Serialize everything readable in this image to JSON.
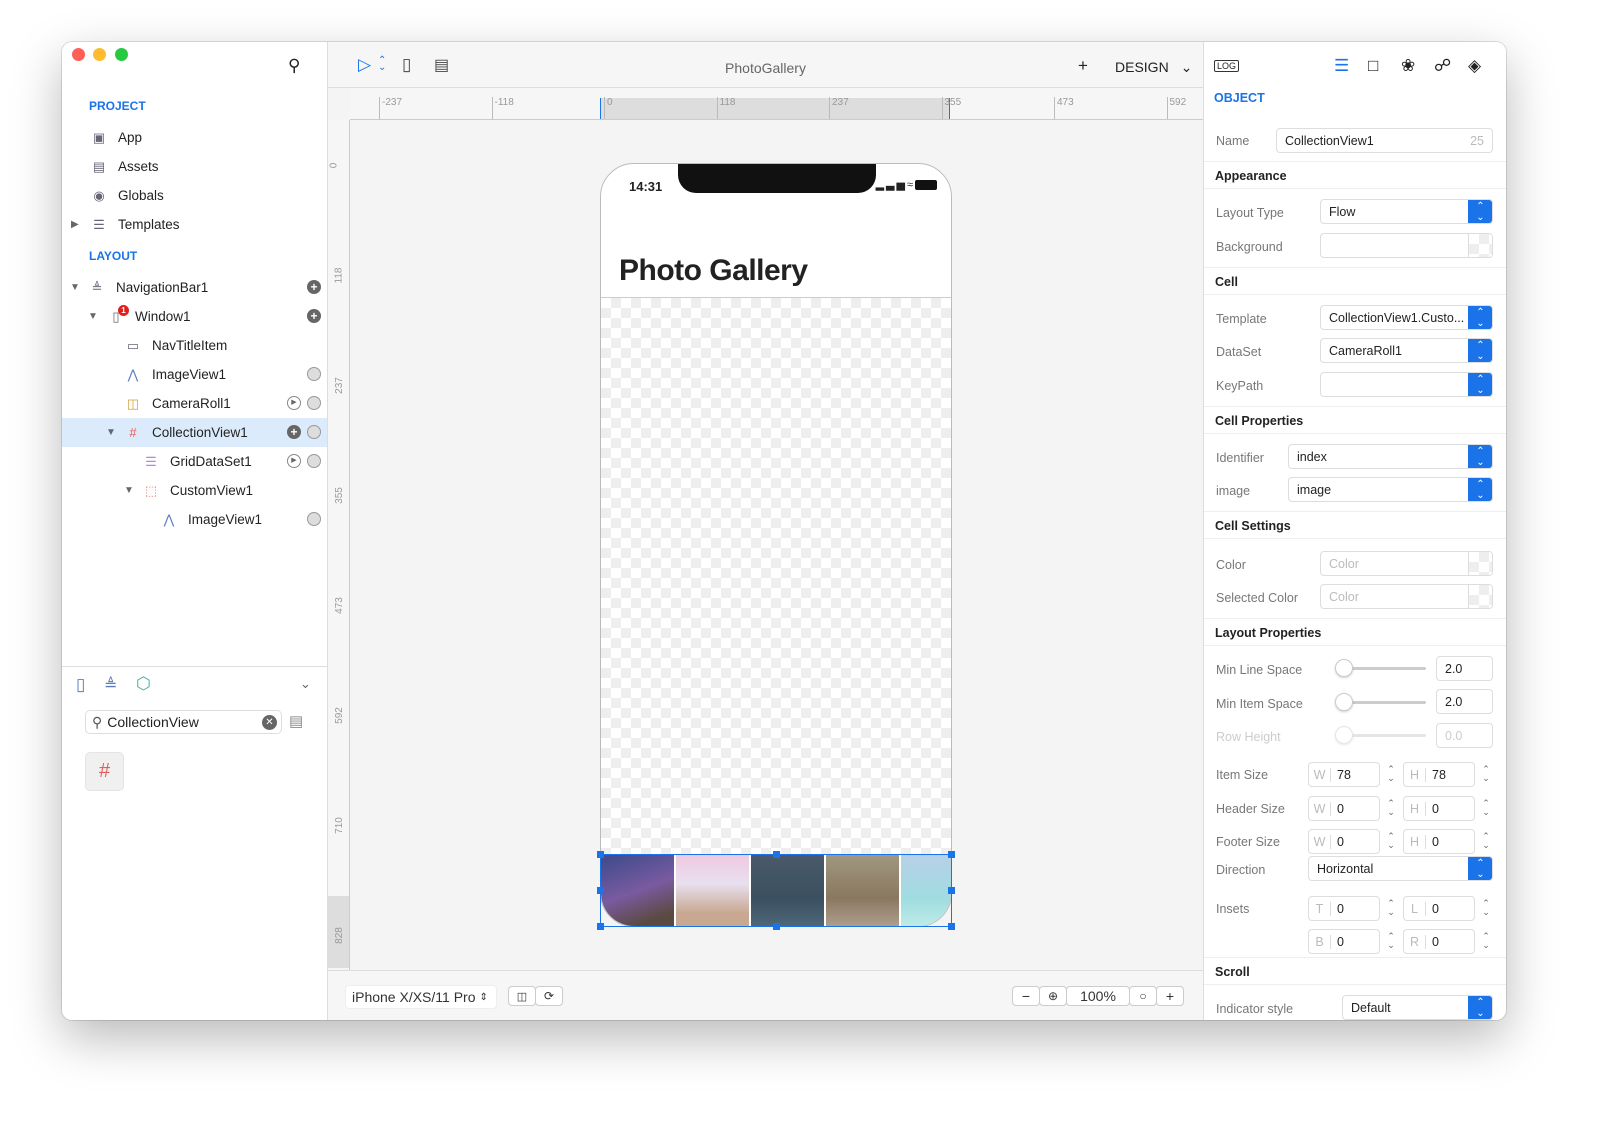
{
  "window": {
    "title": "PhotoGallery"
  },
  "toolbar": {
    "add": "+",
    "mode": "DESIGN"
  },
  "sidebar": {
    "project_label": "PROJECT",
    "project_items": [
      {
        "label": "App",
        "icon": "app-icon"
      },
      {
        "label": "Assets",
        "icon": "briefcase-icon"
      },
      {
        "label": "Globals",
        "icon": "globe-icon"
      },
      {
        "label": "Templates",
        "icon": "templates-icon"
      }
    ],
    "layout_label": "LAYOUT",
    "tree": [
      {
        "label": "NavigationBar1",
        "icon": "navbar-icon",
        "expanded": true
      },
      {
        "label": "Window1",
        "icon": "window-icon",
        "badge": "1",
        "expanded": true
      },
      {
        "label": "NavTitleItem",
        "icon": "nav-title-icon"
      },
      {
        "label": "ImageView1",
        "icon": "image-icon"
      },
      {
        "label": "CameraRoll1",
        "icon": "camera-roll-icon"
      },
      {
        "label": "CollectionView1",
        "icon": "grid-icon",
        "selected": true,
        "expanded": true
      },
      {
        "label": "GridDataSet1",
        "icon": "dataset-icon"
      },
      {
        "label": "CustomView1",
        "icon": "custom-view-icon",
        "expanded": true
      },
      {
        "label": "ImageView1",
        "icon": "image-icon"
      }
    ],
    "library_search": "CollectionView"
  },
  "rulers": {
    "h": [
      "-237",
      "-118",
      "0",
      "118",
      "237",
      "355",
      "473",
      "592"
    ],
    "v": [
      "0",
      "118",
      "237",
      "355",
      "473",
      "592",
      "710",
      "828"
    ]
  },
  "phone": {
    "time": "14:31",
    "title": "Photo Gallery"
  },
  "bottom": {
    "device": "iPhone X/XS/11 Pro",
    "zoom": "100%",
    "zoom_out": "−",
    "zoom_in": "+"
  },
  "inspector": {
    "log": "LOG",
    "section": "OBJECT",
    "name_label": "Name",
    "name_value": "CollectionView1",
    "name_count": "25",
    "appearance": "Appearance",
    "layout_type_label": "Layout Type",
    "layout_type": "Flow",
    "background_label": "Background",
    "cell": "Cell",
    "template_label": "Template",
    "template": "CollectionView1.Custo...",
    "dataset_label": "DataSet",
    "dataset": "CameraRoll1",
    "keypath_label": "KeyPath",
    "cell_properties": "Cell Properties",
    "identifier_label": "Identifier",
    "identifier": "index",
    "image_label": "image",
    "image": "image",
    "cell_settings": "Cell Settings",
    "color_label": "Color",
    "color_ph": "Color",
    "selected_color_label": "Selected Color",
    "selected_color_ph": "Color",
    "layout_properties": "Layout Properties",
    "min_line_label": "Min Line Space",
    "min_line": "2.0",
    "min_item_label": "Min Item Space",
    "min_item": "2.0",
    "row_height_label": "Row Height",
    "row_height": "0.0",
    "item_size_label": "Item Size",
    "item_w": "78",
    "item_h": "78",
    "header_size_label": "Header Size",
    "header_w": "0",
    "header_h": "0",
    "footer_size_label": "Footer Size",
    "footer_w": "0",
    "footer_h": "0",
    "direction_label": "Direction",
    "direction": "Horizontal",
    "insets_label": "Insets",
    "inset_t": "0",
    "inset_l": "0",
    "inset_b": "0",
    "inset_r": "0",
    "k_w": "W",
    "k_h": "H",
    "k_t": "T",
    "k_l": "L",
    "k_b": "B",
    "k_r": "R",
    "scroll": "Scroll",
    "indicator_label": "Indicator style",
    "indicator": "Default"
  },
  "colors": {
    "accent": "#1a73e8",
    "selection": "#dcebfb"
  }
}
